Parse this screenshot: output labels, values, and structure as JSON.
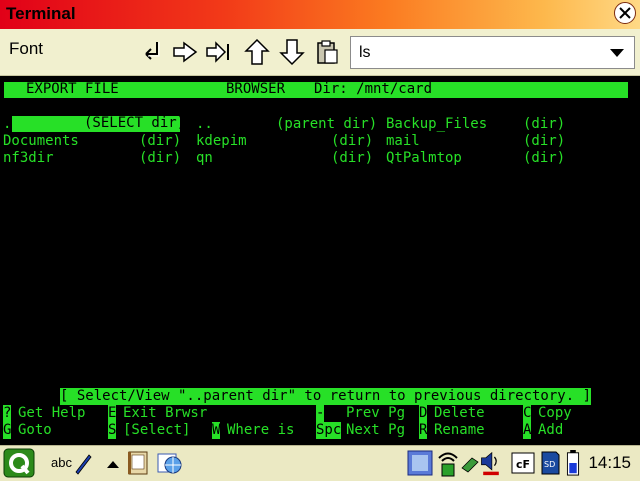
{
  "window": {
    "title": "Terminal"
  },
  "toolbar": {
    "font_label": "Font",
    "command_value": "ls"
  },
  "terminal": {
    "header": {
      "col1": "EXPORT FILE",
      "col2": "BROWSER",
      "col3": "Dir: /mnt/card"
    },
    "entries": [
      {
        "name": ".",
        "type": "(SELECT dir)",
        "selected": true
      },
      {
        "name": "..",
        "type": "(parent dir)"
      },
      {
        "name": "Backup_Files",
        "type": "(dir)"
      },
      {
        "name": "Documents",
        "type": "(dir)"
      },
      {
        "name": "kdepim",
        "type": "(dir)"
      },
      {
        "name": "mail",
        "type": "(dir)"
      },
      {
        "name": "nf3dir",
        "type": "(dir)"
      },
      {
        "name": "qn",
        "type": "(dir)"
      },
      {
        "name": "QtPalmtop",
        "type": "(dir)"
      }
    ],
    "status_message": "[ Select/View \"..parent dir\" to return to previous directory. ]",
    "commands": [
      {
        "key": "?",
        "label": "Get Help"
      },
      {
        "key": "E",
        "label": "Exit Brwsr"
      },
      {
        "key": "-",
        "label": "Prev Pg"
      },
      {
        "key": "D",
        "label": "Delete"
      },
      {
        "key": "C",
        "label": "Copy"
      },
      {
        "key": "G",
        "label": "Goto"
      },
      {
        "key": "S",
        "label": "[Select]"
      },
      {
        "key": "W",
        "label": "Where is"
      },
      {
        "key": "Spc",
        "label": "Next Pg"
      },
      {
        "key": "R",
        "label": "Rename"
      },
      {
        "key": "A",
        "label": "Add"
      }
    ]
  },
  "taskbar": {
    "input_method": "abc",
    "clock": "14:15"
  },
  "colors": {
    "terminal_fg": "#27e027",
    "terminal_bg": "#000000"
  }
}
